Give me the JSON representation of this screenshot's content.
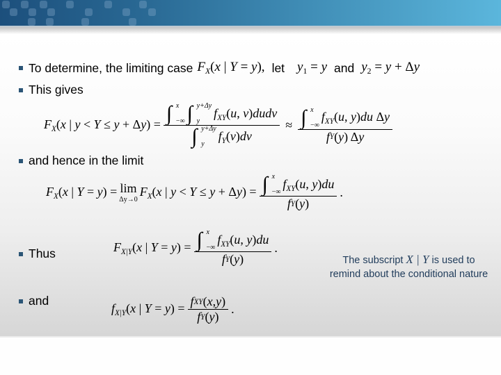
{
  "theme": {
    "header_gradient_start": "#1c4f7c",
    "header_gradient_end": "#5bb6dc",
    "bullet_color": "#2b5576",
    "note_color": "#1f3b5a"
  },
  "bullets": [
    {
      "text": "To determine, the limiting case",
      "math_1": "F_X(x | Y = y),",
      "connector_1": "let",
      "math_2": "y_1 = y",
      "connector_2": "and",
      "math_3": "y_2 = y + Δy"
    },
    {
      "text": "This gives"
    },
    {
      "text": "and hence in the limit"
    },
    {
      "text": "Thus"
    },
    {
      "text": "and"
    }
  ],
  "equations": {
    "eq1": {
      "lhs": "F_X(x | y < Y ≤ y + Δy) =",
      "num_outer_upper": "x",
      "num_outer_lower": "−∞",
      "num_inner_upper": "y+Δy",
      "num_inner_lower": "y",
      "num_integrand": "f_XY(u, v)dudv",
      "den_upper": "y+Δy",
      "den_lower": "y",
      "den_integrand": "f_Y(v)dv",
      "approx": "≈",
      "rhs_num_upper": "x",
      "rhs_num_lower": "−∞",
      "rhs_num_integrand": "f_XY(u, y)du Δy",
      "rhs_den": "f_Y(y) Δy"
    },
    "eq2": {
      "lhs": "F_X(x | Y = y) =",
      "lim_label": "lim",
      "lim_under": "Δy→0",
      "mid": "F_X(x | y < Y ≤ y + Δy) =",
      "num_upper": "x",
      "num_lower": "−∞",
      "num_integrand": "f_XY(u, y)du",
      "den": "f_Y(y)",
      "end": "."
    },
    "eq3": {
      "lhs": "F_X|Y(x | Y = y) =",
      "num_upper": "x",
      "num_lower": "−∞",
      "num_integrand": "f_XY(u, y)du",
      "den": "f_Y(y)",
      "end": "."
    },
    "eq4": {
      "lhs": "f_X|Y(x | Y = y) =",
      "num": "f_XY(x, y)",
      "den": "f_Y(y)",
      "end": "."
    }
  },
  "note": {
    "prefix": "The subscript",
    "math": "X | Y",
    "suffix": "is used to",
    "line2": "remind about the conditional nature"
  }
}
